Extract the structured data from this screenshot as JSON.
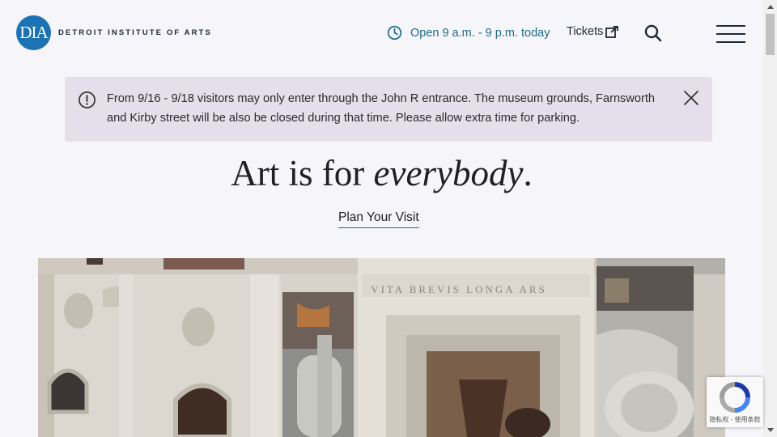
{
  "header": {
    "logo_mark": "DIA",
    "logo_text": "DETROIT INSTITUTE OF ARTS",
    "hours": "Open 9 a.m. - 9 p.m. today",
    "tickets_label": "Tickets",
    "accent_color": "#1d6a86",
    "logo_color": "#1b73b3"
  },
  "alert": {
    "message": "From 9/16 - 9/18 visitors may only enter through the John R entrance. The museum grounds, Farnsworth and Kirby street will be also be closed during that time. Please allow extra time for parking.",
    "background": "#e5dfeb"
  },
  "hero": {
    "headline_prefix": "Art is for",
    "headline_emphasis": "everybody",
    "headline_suffix": ".",
    "cta_label": "Plan Your Visit",
    "carved_inscription": "VITA BREVIS LONGA ARS"
  },
  "recaptcha": {
    "label": "隐私权 - 使用条款"
  },
  "icons": [
    "clock-icon",
    "external-link-icon",
    "search-icon",
    "hamburger-menu-icon",
    "alert-circle-icon",
    "close-icon",
    "recaptcha-icon"
  ]
}
